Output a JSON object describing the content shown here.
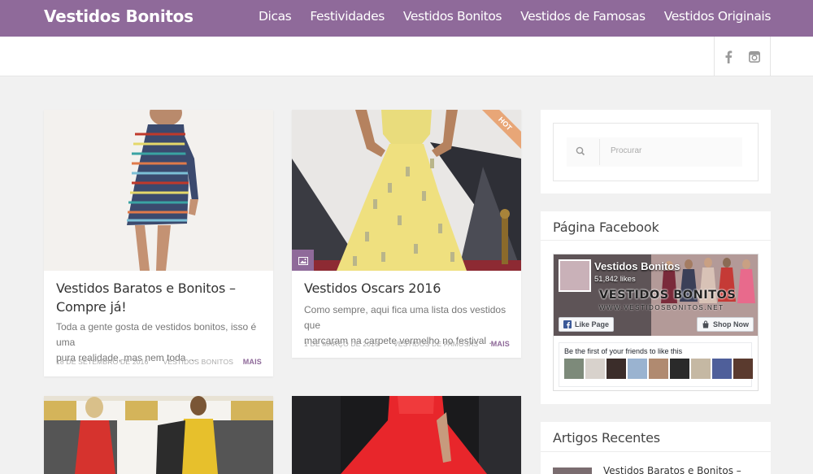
{
  "header": {
    "logo": "Vestidos Bonitos",
    "nav": [
      "Dicas",
      "Festividades",
      "Vestidos Bonitos",
      "Vestidos de Famosas",
      "Vestidos Originais"
    ]
  },
  "social": {
    "icons": [
      "facebook-icon",
      "instagram-icon"
    ]
  },
  "posts": [
    {
      "title_line1": "Vestidos Baratos e Bonitos –",
      "title_line2": "Compre já!",
      "excerpt_line1": "Toda a gente gosta de vestidos bonitos, isso é uma",
      "excerpt_line2": "pura realidade, mas nem toda ...",
      "date": "18 DE SETEMBRO DE 2016",
      "category": "VESTIDOS BONITOS",
      "more": "MAIS"
    },
    {
      "badge": "HOT",
      "title_line1": "Vestidos Oscars 2016",
      "excerpt_line1": "Como sempre, aqui fica uma lista dos vestidos que",
      "excerpt_line2": "marcaram na carpete vermelho no festival ...",
      "date": "1 DE MARÇO DE 2016",
      "category": "VESTIDOS DE FAMOSAS",
      "more": "MAIS"
    }
  ],
  "sidebar": {
    "search_placeholder": "Procurar",
    "facebook_title": "Página Facebook",
    "fb": {
      "page_name": "Vestidos Bonitos",
      "likes": "51,842 likes",
      "brand": "VESTIDOS BONITOS",
      "url": "WWW.VESTIDOSBONITOS.NET",
      "like_button": "Like Page",
      "shop_button": "Shop Now",
      "friends_text": "Be the first of your friends to like this"
    },
    "recent_title": "Artigos Recentes",
    "recent_item": "Vestidos Baratos e Bonitos –"
  },
  "colors": {
    "brand": "#8f6a9a",
    "hot": "#e8a677",
    "background": "#f1f1f1"
  }
}
